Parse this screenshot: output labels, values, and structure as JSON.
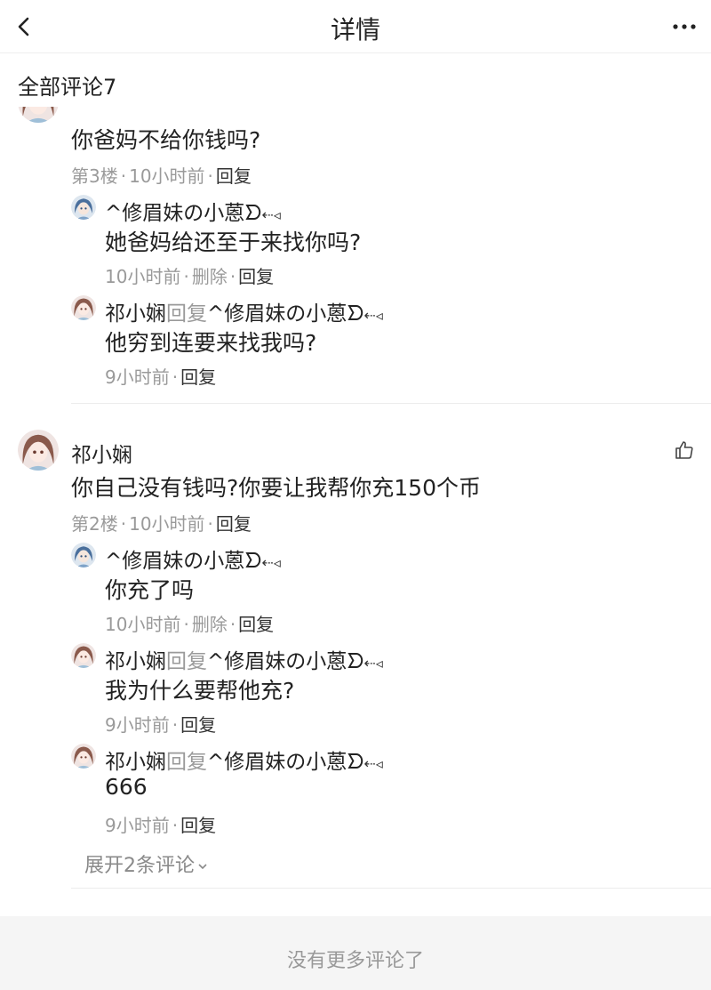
{
  "header": {
    "title": "详情"
  },
  "section": {
    "title": "全部评论7"
  },
  "colors": {
    "meta": "#9a9a9a",
    "text": "#222222",
    "footer_bg": "#f5f5f5"
  },
  "comments": [
    {
      "text": "你爸妈不给你钱吗?",
      "floor": "第3楼",
      "time": "10小时前",
      "reply": "回复",
      "replies": [
        {
          "author": "^修眉妹の小蒽ᗤ",
          "emote": "⇠◃",
          "text": "她爸妈给还至于来找你吗?",
          "time": "10小时前",
          "delete": "删除",
          "reply": "回复"
        },
        {
          "author": "祁小娴",
          "reply_word": "回复",
          "target": "^修眉妹の小蒽ᗤ",
          "emote": "⇠◃",
          "text": "他穷到连要来找我吗?",
          "time": "9小时前",
          "reply": "回复"
        }
      ]
    },
    {
      "author": "祁小娴",
      "text": "你自己没有钱吗?你要让我帮你充150个币",
      "floor": "第2楼",
      "time": "10小时前",
      "reply": "回复",
      "replies": [
        {
          "author": "^修眉妹の小蒽ᗤ",
          "emote": "⇠◃",
          "text": "你充了吗",
          "time": "10小时前",
          "delete": "删除",
          "reply": "回复"
        },
        {
          "author": "祁小娴",
          "reply_word": "回复",
          "target": "^修眉妹の小蒽ᗤ",
          "emote": "⇠◃",
          "text": "我为什么要帮他充?",
          "time": "9小时前",
          "reply": "回复"
        },
        {
          "author": "祁小娴",
          "reply_word": "回复",
          "target": "^修眉妹の小蒽ᗤ",
          "emote": "⇠◃",
          "text": "666",
          "time": "9小时前",
          "reply": "回复"
        }
      ],
      "expand": "展开2条评论"
    }
  ],
  "footer": {
    "text": "没有更多评论了"
  }
}
